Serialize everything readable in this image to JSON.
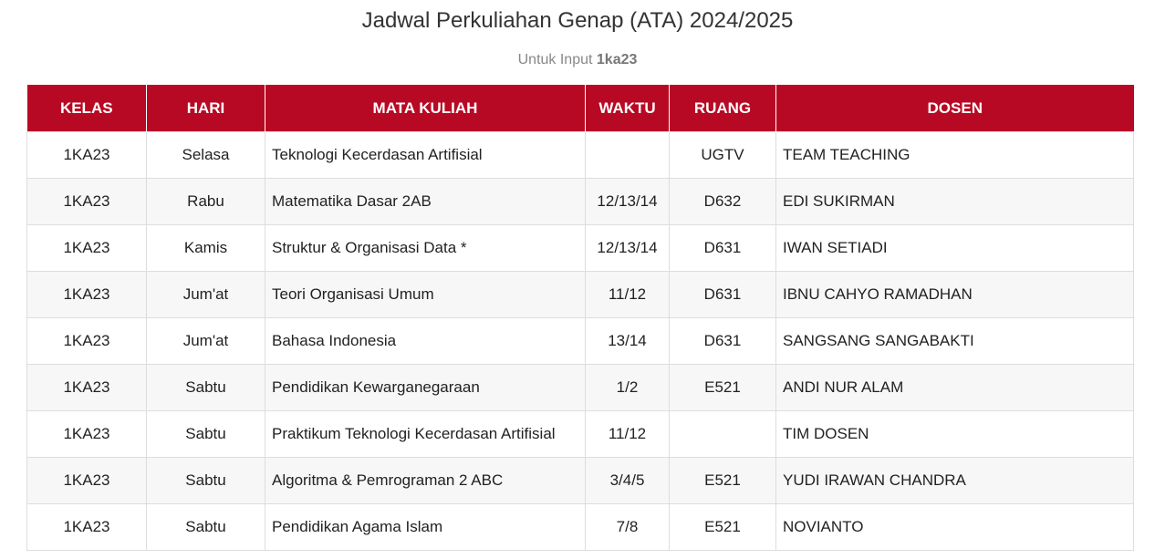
{
  "title": "Jadwal Perkuliahan Genap (ATA) 2024/2025",
  "subtitle": {
    "prefix": "Untuk Input",
    "value": "1ka23"
  },
  "colors": {
    "header_bg": "#b80924",
    "header_text": "#ffffff",
    "row_alt": "#f7f7f7",
    "border": "#dddddd"
  },
  "table": {
    "headers": {
      "kelas": "KELAS",
      "hari": "HARI",
      "mata_kuliah": "MATA KULIAH",
      "waktu": "WAKTU",
      "ruang": "RUANG",
      "dosen": "DOSEN"
    },
    "rows": [
      {
        "kelas": "1KA23",
        "hari": "Selasa",
        "mata_kuliah": "Teknologi Kecerdasan Artifisial",
        "waktu": "",
        "ruang": "UGTV",
        "dosen": "TEAM TEACHING"
      },
      {
        "kelas": "1KA23",
        "hari": "Rabu",
        "mata_kuliah": "Matematika Dasar 2AB",
        "waktu": "12/13/14",
        "ruang": "D632",
        "dosen": "EDI SUKIRMAN"
      },
      {
        "kelas": "1KA23",
        "hari": "Kamis",
        "mata_kuliah": "Struktur & Organisasi Data *",
        "waktu": "12/13/14",
        "ruang": "D631",
        "dosen": "IWAN SETIADI"
      },
      {
        "kelas": "1KA23",
        "hari": "Jum'at",
        "mata_kuliah": "Teori Organisasi Umum",
        "waktu": "11/12",
        "ruang": "D631",
        "dosen": "IBNU CAHYO RAMADHAN"
      },
      {
        "kelas": "1KA23",
        "hari": "Jum'at",
        "mata_kuliah": "Bahasa Indonesia",
        "waktu": "13/14",
        "ruang": "D631",
        "dosen": "SANGSANG SANGABAKTI"
      },
      {
        "kelas": "1KA23",
        "hari": "Sabtu",
        "mata_kuliah": "Pendidikan Kewarganegaraan",
        "waktu": "1/2",
        "ruang": "E521",
        "dosen": "ANDI NUR ALAM"
      },
      {
        "kelas": "1KA23",
        "hari": "Sabtu",
        "mata_kuliah": "Praktikum Teknologi Kecerdasan Artifisial",
        "waktu": "11/12",
        "ruang": "",
        "dosen": "TIM DOSEN"
      },
      {
        "kelas": "1KA23",
        "hari": "Sabtu",
        "mata_kuliah": "Algoritma & Pemrograman 2 ABC",
        "waktu": "3/4/5",
        "ruang": "E521",
        "dosen": "YUDI IRAWAN CHANDRA"
      },
      {
        "kelas": "1KA23",
        "hari": "Sabtu",
        "mata_kuliah": "Pendidikan Agama Islam",
        "waktu": "7/8",
        "ruang": "E521",
        "dosen": "NOVIANTO"
      }
    ]
  }
}
